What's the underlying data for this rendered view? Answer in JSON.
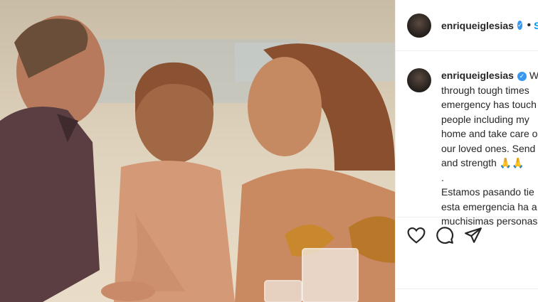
{
  "post": {
    "username": "enriqueiglesias",
    "follow_label": "S",
    "separator": "•"
  },
  "caption": {
    "username": "enriqueiglesias",
    "text": "W\nthrough tough times\nemergency has touch\npeople including my\nhome and take care o\nour loved ones. Send\nand strength 🙏🙏\n.\nEstamos pasando tie\nesta emergencia ha a\nmuchisimas personas"
  },
  "icons": {
    "verified": "verified-badge-icon",
    "like": "heart-icon",
    "comment": "comment-icon",
    "share": "share-icon"
  },
  "colors": {
    "accent": "#0095f6",
    "verified": "#3897f0",
    "text": "#262626",
    "border": "#efefef"
  }
}
